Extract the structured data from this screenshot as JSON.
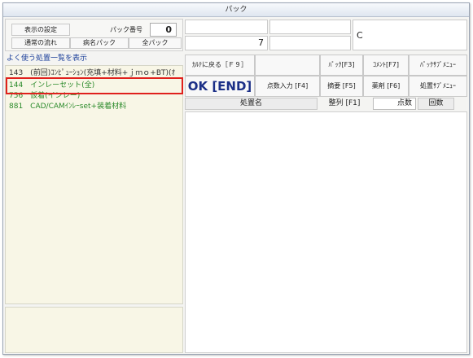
{
  "window": {
    "title": "パック"
  },
  "left_header": {
    "settings_button": "表示の設定",
    "pack_number_label": "パック番号",
    "pack_number_value": "0",
    "flow_button": "通常の流れ",
    "disease_pack_button": "病名パック",
    "all_pack_button": "全パック"
  },
  "frequent": {
    "header": "よく使う処置一覧を表示",
    "items": [
      {
        "label": "143　(前回)ｺﾝﾋﾟｭｰｼｮﾝ(充填+材料+ｊｍｏ+BT)(ｵ",
        "color": "#333333"
      },
      {
        "label": "144　インレーセット(全)",
        "color": "#2a8a2a"
      },
      {
        "label": "756　仮着(インレー)",
        "color": "#2a8a2a"
      },
      {
        "label": "881　CAD/CAMｲﾝﾚｰset+装着材料",
        "color": "#2a8a2a"
      }
    ],
    "highlight_color": "#e0201c"
  },
  "top_fields": {
    "count_value": "7",
    "code_value": "C"
  },
  "actions": {
    "back_to_chart": "ｶﾙﾃに戻る［Ｆ９］",
    "pack_f3": "ﾊﾟｯｸ[F3]",
    "comment_f7": "ｺﾒﾝﾄ[F7]",
    "pack_submenu": "ﾊﾟｯｸｻﾌﾞﾒﾆｭｰ",
    "ok_end": "OK [END]",
    "score_input": "点数入力 [F4]",
    "summary_f5": "摘要 [F5]",
    "drug_f6": "薬剤 [F6]",
    "treatment_submenu": "処置ｻﾌﾞﾒﾆｭｰ"
  },
  "table_header": {
    "treatment_name": "処置名",
    "sort_f1": "整列 [F1]",
    "points": "点数",
    "times": "回数"
  },
  "colors": {
    "ok_text": "#1b2f87",
    "accent_border": "#e0201c"
  }
}
